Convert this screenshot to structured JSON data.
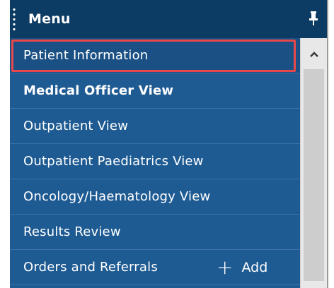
{
  "menu": {
    "title": "Menu",
    "items": [
      {
        "label": "Patient Information",
        "selected": true,
        "bold": false
      },
      {
        "label": "Medical Officer View",
        "selected": false,
        "bold": true
      },
      {
        "label": "Outpatient View",
        "selected": false,
        "bold": false
      },
      {
        "label": "Outpatient Paediatrics View",
        "selected": false,
        "bold": false
      },
      {
        "label": "Oncology/Haematology View",
        "selected": false,
        "bold": false
      },
      {
        "label": "Results Review",
        "selected": false,
        "bold": false
      },
      {
        "label": "Orders and Referrals",
        "selected": false,
        "bold": false,
        "add_label": "Add"
      }
    ]
  },
  "icons": {
    "pin": "pin-icon",
    "grip": "drag-grip-icon",
    "scroll_up": "chevron-up-icon",
    "add": "plus-icon"
  },
  "colors": {
    "header_bg": "#0c3b63",
    "list_bg": "#1f5b93",
    "highlight_border": "#e8484a"
  }
}
